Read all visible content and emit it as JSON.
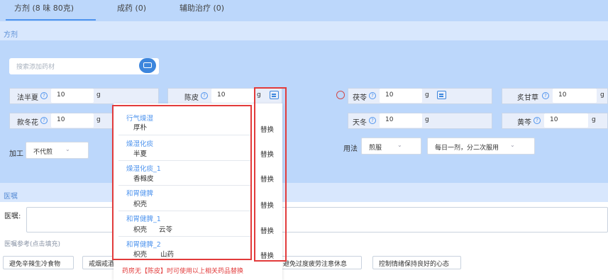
{
  "tabs": [
    "方剂 (8 味  80克)",
    "成药 (0)",
    "辅助治疗 (0)"
  ],
  "prescription_section": {
    "title": "方剂"
  },
  "search": {
    "placeholder": "搜索添加药材"
  },
  "unit": "g",
  "herbs": [
    {
      "name": "法半夏",
      "dose": "10"
    },
    {
      "name": "陈皮",
      "dose": "10"
    },
    {
      "name": "茯苓",
      "dose": "10"
    },
    {
      "name": "炙甘草",
      "dose": "10"
    },
    {
      "name": "款冬花",
      "dose": "10"
    },
    {
      "name": "天冬",
      "dose": "10"
    },
    {
      "name": "黄芩",
      "dose": "10"
    }
  ],
  "processing": {
    "label": "加工",
    "value": "不代煎"
  },
  "usage": {
    "label": "用法",
    "method": "煎服",
    "frequency": "每日一剂，分二次服用"
  },
  "advice_section": {
    "title": "医嘱",
    "label": "医嘱:",
    "ref_label": "医嘱参考(点击填充)"
  },
  "advice_chips": [
    "避免辛辣生冷食物",
    "戒烟戒酒",
    "避免过度疲劳注意休息",
    "控制情绪保持良好的心态"
  ],
  "substitution_popup": {
    "options": [
      {
        "group": "行气燥湿",
        "herbs": [
          "厚朴"
        ]
      },
      {
        "group": "燥湿化痰",
        "herbs": [
          "半夏"
        ]
      },
      {
        "group": "燥湿化痰_1",
        "herbs": [
          "香橼皮"
        ]
      },
      {
        "group": "和胃健脾",
        "herbs": [
          "枳壳"
        ]
      },
      {
        "group": "和胃健脾_1",
        "herbs": [
          "枳壳",
          "云苓"
        ]
      },
      {
        "group": "和胃健脾_2",
        "herbs": [
          "枳壳",
          "山药"
        ]
      }
    ],
    "action_label": "替换",
    "footnote": "药房无【陈皮】时可使用以上相关药品替换"
  }
}
